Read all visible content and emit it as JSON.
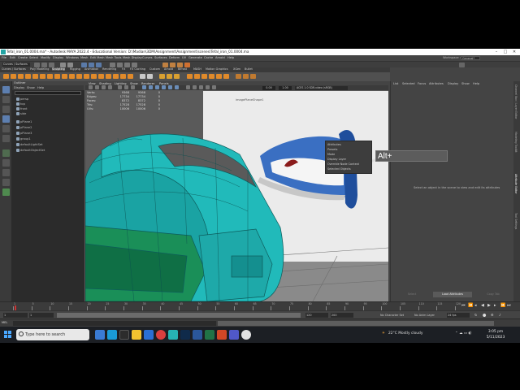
{
  "window": {
    "title": "Tefal_iron_01.0004.ma* - Autodesk MAYA 2022.4 - Educational Version: D:\\Madian\\3DM\\Assignment\\Assignment\\scenes\\Tefal_iron_01.0004.ma"
  },
  "menu": {
    "items": [
      "File",
      "Edit",
      "Create",
      "Select",
      "Modify",
      "Display",
      "Windows",
      "Mesh",
      "Edit Mesh",
      "Mesh Tools",
      "Mesh Display",
      "Curves",
      "Surfaces",
      "Deform",
      "UV",
      "Generate",
      "Cache",
      "Arnold",
      "Help"
    ],
    "workspace_label": "Workspace :",
    "workspace_value": "General*"
  },
  "status_line": {
    "mode": "Curves / Surfaces"
  },
  "shelf_tabs": [
    "Curves / Surfaces",
    "Poly Modeling",
    "Sculpting",
    "Rigging",
    "Animation",
    "Rendering",
    "FX",
    "FX Caching",
    "Custom",
    "Arnold",
    "Bifrost",
    "MASH",
    "Motion Graphics",
    "XGen",
    "Bullet"
  ],
  "outliner": {
    "title": "Outliner",
    "menu": [
      "Display",
      "Show",
      "Help"
    ],
    "items": [
      "persp",
      "top",
      "front",
      "side",
      "pPlane1",
      "pPlane2",
      "pPlane3",
      "group1",
      "defaultLightSet",
      "defaultObjectSet"
    ]
  },
  "viewport": {
    "menu": [
      "View",
      "Shading",
      "Lighting",
      "Show",
      "Renderer",
      "Panels"
    ],
    "near_value": "0.00",
    "far_value": "1.00",
    "color_space": "ACES 1.0 SDR-video (sRGB)",
    "hud": [
      {
        "label": "Verts:",
        "a": "9368",
        "b": "9368",
        "c": "0"
      },
      {
        "label": "Edges:",
        "a": "17734",
        "b": "17734",
        "c": "0"
      },
      {
        "label": "Faces:",
        "a": "8372",
        "b": "8372",
        "c": "0"
      },
      {
        "label": "Tris:",
        "a": "17528",
        "b": "17528",
        "c": "0"
      },
      {
        "label": "UVs:",
        "a": "10006",
        "b": "10006",
        "c": "0"
      }
    ],
    "reference_label": "imagePlaneShape1"
  },
  "attribute_popup": {
    "items": [
      "Attributes",
      "Presets",
      "Mode",
      "Display Layer",
      "Override Node Context",
      "Selected Objects"
    ]
  },
  "key_overlay": "Alt+",
  "attribute_editor": {
    "menu": [
      "List",
      "Selected",
      "Focus",
      "Attributes",
      "Display",
      "Show",
      "Help"
    ],
    "message": "Select an object in the scene to view and edit its attributes",
    "tabs": [
      "Select",
      "Load Attributes",
      "Copy Tab"
    ],
    "side_tabs": [
      "Channel Box / Layer Editor",
      "Modeling Toolkit",
      "Attribute Editor",
      "Tool Settings"
    ]
  },
  "timeline": {
    "ticks": [
      "1",
      "5",
      "10",
      "15",
      "20",
      "25",
      "30",
      "35",
      "40",
      "45",
      "50",
      "55",
      "60",
      "65",
      "70",
      "75",
      "80",
      "85",
      "90",
      "95",
      "100",
      "105",
      "110",
      "115",
      "120"
    ],
    "start": "1",
    "range_start": "1",
    "range_end": "120",
    "end": "200",
    "character_set": "No Character Set",
    "anim_layer": "No Anim Layer",
    "fps": "24 fps"
  },
  "command_line": {
    "mel_label": "MEL"
  },
  "taskbar": {
    "search_placeholder": "Type here to search",
    "weather": "22°C  Mostly cloudy",
    "time": "3:05 pm",
    "date": "5/11/2023",
    "app_icons": [
      "file-explorer",
      "edge",
      "store",
      "mail",
      "chrome",
      "maya",
      "photoshop",
      "word",
      "excel",
      "powerpoint",
      "teams",
      "explorer",
      "chrome-2"
    ]
  },
  "colors": {
    "mesh": "#1fb7b7",
    "mesh_dark": "#138a8a",
    "mesh_green": "#1a8f58",
    "iron_blue": "#2e66b0",
    "maya_teal": "#27b3b3"
  }
}
